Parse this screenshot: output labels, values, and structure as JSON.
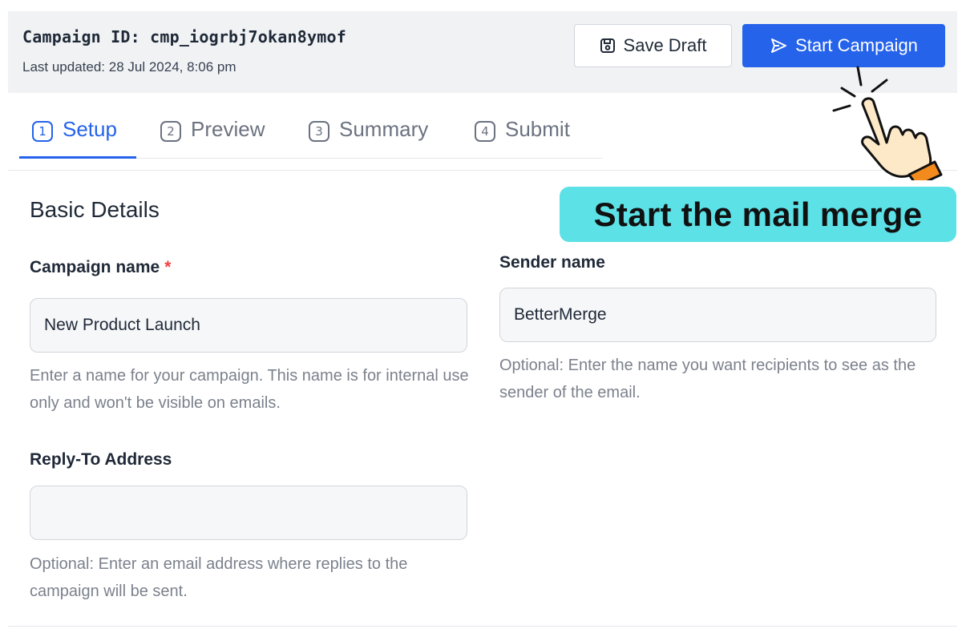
{
  "header": {
    "campaign_id": "Campaign ID: cmp_iogrbj7okan8ymof",
    "last_updated": "Last updated: 28 Jul 2024, 8:06 pm"
  },
  "actions": {
    "save_draft": {
      "label": "Save Draft",
      "icon": "save-icon"
    },
    "start_campaign": {
      "label": "Start Campaign",
      "icon": "send-icon"
    }
  },
  "tabs": [
    {
      "number": "1",
      "label": "Setup",
      "active": true
    },
    {
      "number": "2",
      "label": "Preview",
      "active": false
    },
    {
      "number": "3",
      "label": "Summary",
      "active": false
    },
    {
      "number": "4",
      "label": "Submit",
      "active": false
    }
  ],
  "section": {
    "title": "Basic Details"
  },
  "fields": {
    "campaign_name": {
      "label": "Campaign name",
      "required_mark": "*",
      "value": "New Product Launch",
      "help": "Enter a name for your campaign. This name is for internal use only and won't be visible on emails."
    },
    "sender_name": {
      "label": "Sender name",
      "value": "BetterMerge",
      "help": "Optional: Enter the name you want recipients to see as the sender of the email."
    },
    "reply_to": {
      "label": "Reply-To Address",
      "value": "",
      "help": "Optional: Enter an email address where replies to the campaign will be sent."
    }
  },
  "annotation": {
    "callout_text": "Start the mail merge",
    "callout_color": "#5ce1e6",
    "pointer_icon": "pointing-hand-icon"
  },
  "colors": {
    "accent": "#2563eb",
    "required": "#ef4444",
    "header_bg": "#f1f2f4"
  }
}
